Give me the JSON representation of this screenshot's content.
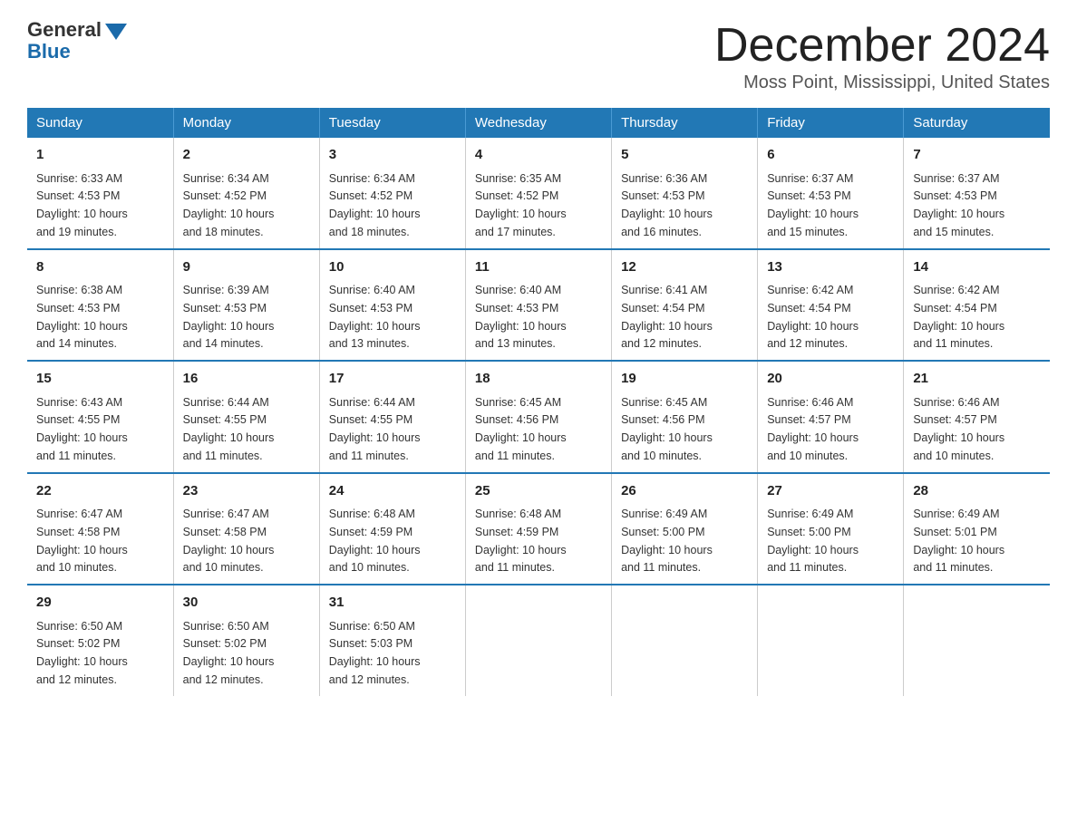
{
  "logo": {
    "general": "General",
    "blue": "Blue"
  },
  "header": {
    "month": "December 2024",
    "location": "Moss Point, Mississippi, United States"
  },
  "days_of_week": [
    "Sunday",
    "Monday",
    "Tuesday",
    "Wednesday",
    "Thursday",
    "Friday",
    "Saturday"
  ],
  "weeks": [
    [
      {
        "day": "1",
        "sunrise": "6:33 AM",
        "sunset": "4:53 PM",
        "daylight": "10 hours and 19 minutes."
      },
      {
        "day": "2",
        "sunrise": "6:34 AM",
        "sunset": "4:52 PM",
        "daylight": "10 hours and 18 minutes."
      },
      {
        "day": "3",
        "sunrise": "6:34 AM",
        "sunset": "4:52 PM",
        "daylight": "10 hours and 18 minutes."
      },
      {
        "day": "4",
        "sunrise": "6:35 AM",
        "sunset": "4:52 PM",
        "daylight": "10 hours and 17 minutes."
      },
      {
        "day": "5",
        "sunrise": "6:36 AM",
        "sunset": "4:53 PM",
        "daylight": "10 hours and 16 minutes."
      },
      {
        "day": "6",
        "sunrise": "6:37 AM",
        "sunset": "4:53 PM",
        "daylight": "10 hours and 15 minutes."
      },
      {
        "day": "7",
        "sunrise": "6:37 AM",
        "sunset": "4:53 PM",
        "daylight": "10 hours and 15 minutes."
      }
    ],
    [
      {
        "day": "8",
        "sunrise": "6:38 AM",
        "sunset": "4:53 PM",
        "daylight": "10 hours and 14 minutes."
      },
      {
        "day": "9",
        "sunrise": "6:39 AM",
        "sunset": "4:53 PM",
        "daylight": "10 hours and 14 minutes."
      },
      {
        "day": "10",
        "sunrise": "6:40 AM",
        "sunset": "4:53 PM",
        "daylight": "10 hours and 13 minutes."
      },
      {
        "day": "11",
        "sunrise": "6:40 AM",
        "sunset": "4:53 PM",
        "daylight": "10 hours and 13 minutes."
      },
      {
        "day": "12",
        "sunrise": "6:41 AM",
        "sunset": "4:54 PM",
        "daylight": "10 hours and 12 minutes."
      },
      {
        "day": "13",
        "sunrise": "6:42 AM",
        "sunset": "4:54 PM",
        "daylight": "10 hours and 12 minutes."
      },
      {
        "day": "14",
        "sunrise": "6:42 AM",
        "sunset": "4:54 PM",
        "daylight": "10 hours and 11 minutes."
      }
    ],
    [
      {
        "day": "15",
        "sunrise": "6:43 AM",
        "sunset": "4:55 PM",
        "daylight": "10 hours and 11 minutes."
      },
      {
        "day": "16",
        "sunrise": "6:44 AM",
        "sunset": "4:55 PM",
        "daylight": "10 hours and 11 minutes."
      },
      {
        "day": "17",
        "sunrise": "6:44 AM",
        "sunset": "4:55 PM",
        "daylight": "10 hours and 11 minutes."
      },
      {
        "day": "18",
        "sunrise": "6:45 AM",
        "sunset": "4:56 PM",
        "daylight": "10 hours and 11 minutes."
      },
      {
        "day": "19",
        "sunrise": "6:45 AM",
        "sunset": "4:56 PM",
        "daylight": "10 hours and 10 minutes."
      },
      {
        "day": "20",
        "sunrise": "6:46 AM",
        "sunset": "4:57 PM",
        "daylight": "10 hours and 10 minutes."
      },
      {
        "day": "21",
        "sunrise": "6:46 AM",
        "sunset": "4:57 PM",
        "daylight": "10 hours and 10 minutes."
      }
    ],
    [
      {
        "day": "22",
        "sunrise": "6:47 AM",
        "sunset": "4:58 PM",
        "daylight": "10 hours and 10 minutes."
      },
      {
        "day": "23",
        "sunrise": "6:47 AM",
        "sunset": "4:58 PM",
        "daylight": "10 hours and 10 minutes."
      },
      {
        "day": "24",
        "sunrise": "6:48 AM",
        "sunset": "4:59 PM",
        "daylight": "10 hours and 10 minutes."
      },
      {
        "day": "25",
        "sunrise": "6:48 AM",
        "sunset": "4:59 PM",
        "daylight": "10 hours and 11 minutes."
      },
      {
        "day": "26",
        "sunrise": "6:49 AM",
        "sunset": "5:00 PM",
        "daylight": "10 hours and 11 minutes."
      },
      {
        "day": "27",
        "sunrise": "6:49 AM",
        "sunset": "5:00 PM",
        "daylight": "10 hours and 11 minutes."
      },
      {
        "day": "28",
        "sunrise": "6:49 AM",
        "sunset": "5:01 PM",
        "daylight": "10 hours and 11 minutes."
      }
    ],
    [
      {
        "day": "29",
        "sunrise": "6:50 AM",
        "sunset": "5:02 PM",
        "daylight": "10 hours and 12 minutes."
      },
      {
        "day": "30",
        "sunrise": "6:50 AM",
        "sunset": "5:02 PM",
        "daylight": "10 hours and 12 minutes."
      },
      {
        "day": "31",
        "sunrise": "6:50 AM",
        "sunset": "5:03 PM",
        "daylight": "10 hours and 12 minutes."
      },
      null,
      null,
      null,
      null
    ]
  ],
  "labels": {
    "sunrise": "Sunrise: ",
    "sunset": "Sunset: ",
    "daylight": "Daylight: "
  }
}
